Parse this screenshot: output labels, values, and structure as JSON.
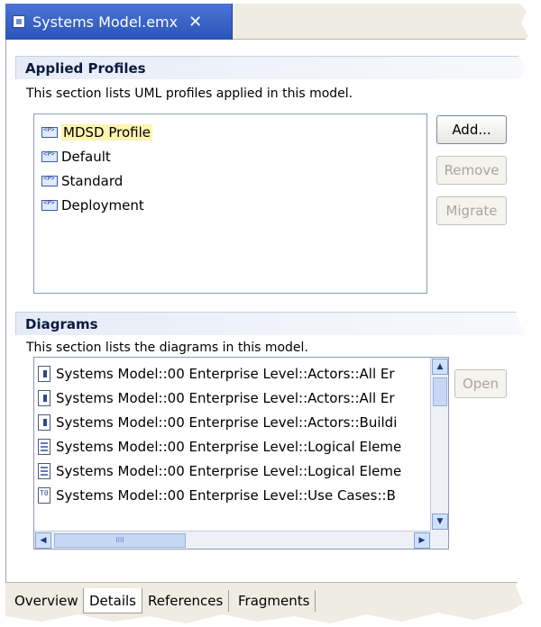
{
  "editor": {
    "tab_title": "Systems Model.emx",
    "close_glyph": "✕"
  },
  "applied_profiles": {
    "title": "Applied Profiles",
    "description": "This section lists UML profiles applied in this model.",
    "items": [
      {
        "label": "MDSD Profile",
        "icon": "profile-icon",
        "selected": true
      },
      {
        "label": "Default",
        "icon": "profile-icon"
      },
      {
        "label": "Standard",
        "icon": "profile-icon"
      },
      {
        "label": "Deployment",
        "icon": "profile-icon"
      }
    ],
    "buttons": {
      "add": "Add...",
      "remove": "Remove",
      "migrate": "Migrate"
    }
  },
  "diagrams": {
    "title": "Diagrams",
    "description": "This section lists the diagrams in this model.",
    "items": [
      {
        "label": "Systems Model::00 Enterprise Level::Actors::All Er",
        "icon": "actor-diagram-icon"
      },
      {
        "label": "Systems Model::00 Enterprise Level::Actors::All Er",
        "icon": "actor-diagram-icon"
      },
      {
        "label": "Systems Model::00 Enterprise Level::Actors::Buildi",
        "icon": "actor-diagram-icon"
      },
      {
        "label": "Systems Model::00 Enterprise Level::Logical Eleme",
        "icon": "logical-diagram-icon"
      },
      {
        "label": "Systems Model::00 Enterprise Level::Logical Eleme",
        "icon": "logical-diagram-icon"
      },
      {
        "label": "Systems Model::00 Enterprise Level::Use Cases::B",
        "icon": "usecase-diagram-icon"
      }
    ],
    "open_button": "Open",
    "scroll_glyphs": {
      "up": "▲",
      "down": "▼",
      "left": "◀",
      "right": "▶",
      "grip": "IIII"
    }
  },
  "bottom_tabs": [
    {
      "label": "Overview"
    },
    {
      "label": "Details",
      "active": true
    },
    {
      "label": "References"
    },
    {
      "label": "Fragments"
    }
  ]
}
